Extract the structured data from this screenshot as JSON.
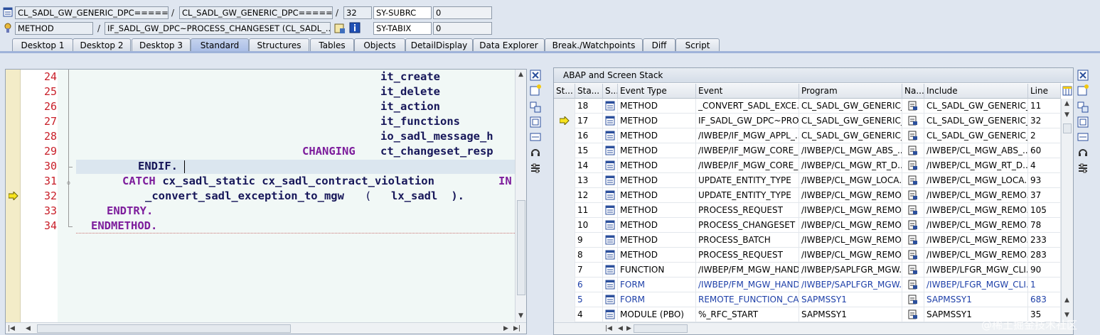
{
  "header": {
    "row1": {
      "field1": "CL_SADL_GW_GENERIC_DPC=======",
      "sep1": "/",
      "field2": "CL_SADL_GW_GENERIC_DPC=======",
      "sep2": "/",
      "line_no": "32",
      "sysvar_name": "SY-SUBRC",
      "sysvar_value": "0"
    },
    "row2": {
      "type": "METHOD",
      "sep": "/",
      "method": "IF_SADL_GW_DPC~PROCESS_CHANGESET (CL_SADL_...",
      "sysvar_name": "SY-TABIX",
      "sysvar_value": "0"
    }
  },
  "tabs": [
    {
      "label": "Desktop 1"
    },
    {
      "label": "Desktop 2"
    },
    {
      "label": "Desktop 3"
    },
    {
      "label": "Standard"
    },
    {
      "label": "Structures"
    },
    {
      "label": "Tables"
    },
    {
      "label": "Objects"
    },
    {
      "label": "DetailDisplay"
    },
    {
      "label": "Data Explorer"
    },
    {
      "label": "Break./Watchpoints"
    },
    {
      "label": "Diff"
    },
    {
      "label": "Script"
    }
  ],
  "code": {
    "lines": [
      {
        "no": "24",
        "parts": [
          {
            "t": "it_create",
            "c": "id"
          }
        ]
      },
      {
        "no": "25",
        "parts": [
          {
            "t": "it_delete",
            "c": "id"
          }
        ]
      },
      {
        "no": "26",
        "parts": [
          {
            "t": "it_action",
            "c": "id"
          }
        ]
      },
      {
        "no": "27",
        "parts": [
          {
            "t": "it_functions",
            "c": "id"
          }
        ]
      },
      {
        "no": "28",
        "parts": [
          {
            "t": "io_sadl_message_h",
            "c": "id"
          }
        ]
      },
      {
        "no": "29",
        "parts": [
          {
            "t": "CHANGING",
            "c": "kw"
          },
          {
            "t": "ct_changeset_resp",
            "c": "id"
          }
        ]
      },
      {
        "no": "30",
        "parts": [
          {
            "t": "ENDIF.",
            "c": "id"
          }
        ]
      },
      {
        "no": "31",
        "parts": [
          {
            "t": "CATCH",
            "c": "kw"
          },
          {
            "t": " cx_sadl_static cx_sadl_contract_violation ",
            "c": "id"
          },
          {
            "t": "IN",
            "c": "kw"
          }
        ]
      },
      {
        "no": "32",
        "parts": [
          {
            "t": "_convert_sadl_exception_to_mgw",
            "c": "id"
          },
          {
            "t": "( ",
            "c": "id"
          },
          {
            "t": "lx_sadl",
            "c": "id"
          },
          {
            "t": " ).",
            "c": "id"
          }
        ]
      },
      {
        "no": "33",
        "parts": [
          {
            "t": "ENDTRY.",
            "c": "kw"
          }
        ]
      },
      {
        "no": "34",
        "parts": [
          {
            "t": "ENDMETHOD.",
            "c": "kw"
          }
        ]
      }
    ]
  },
  "stack": {
    "title": "ABAP and Screen Stack",
    "columns": [
      "St...",
      "Sta...",
      "S...",
      "Event Type",
      "Event",
      "Program",
      "Na...",
      "Include",
      "Line"
    ],
    "rows": [
      {
        "level": "18",
        "type": "METHOD",
        "event": "_CONVERT_SADL_EXCE...",
        "program": "CL_SADL_GW_GENERIC_...",
        "include": "CL_SADL_GW_GENERIC_...",
        "line": "11",
        "current": false,
        "blue": false
      },
      {
        "level": "17",
        "type": "METHOD",
        "event": "IF_SADL_GW_DPC~PRO...",
        "program": "CL_SADL_GW_GENERIC_...",
        "include": "CL_SADL_GW_GENERIC_...",
        "line": "32",
        "current": true,
        "blue": false
      },
      {
        "level": "16",
        "type": "METHOD",
        "event": "/IWBEP/IF_MGW_APPL_...",
        "program": "CL_SADL_GW_GENERIC_...",
        "include": "CL_SADL_GW_GENERIC_...",
        "line": "2",
        "current": false,
        "blue": false
      },
      {
        "level": "15",
        "type": "METHOD",
        "event": "/IWBEP/IF_MGW_CORE_...",
        "program": "/IWBEP/CL_MGW_ABS_...",
        "include": "/IWBEP/CL_MGW_ABS_...",
        "line": "60",
        "current": false,
        "blue": false
      },
      {
        "level": "14",
        "type": "METHOD",
        "event": "/IWBEP/IF_MGW_CORE_...",
        "program": "/IWBEP/CL_MGW_RT_D...",
        "include": "/IWBEP/CL_MGW_RT_D...",
        "line": "4",
        "current": false,
        "blue": false
      },
      {
        "level": "13",
        "type": "METHOD",
        "event": "UPDATE_ENTITY_TYPE",
        "program": "/IWBEP/CL_MGW_LOCA...",
        "include": "/IWBEP/CL_MGW_LOCA...",
        "line": "93",
        "current": false,
        "blue": false
      },
      {
        "level": "12",
        "type": "METHOD",
        "event": "UPDATE_ENTITY_TYPE",
        "program": "/IWBEP/CL_MGW_REMO...",
        "include": "/IWBEP/CL_MGW_REMO...",
        "line": "37",
        "current": false,
        "blue": false
      },
      {
        "level": "11",
        "type": "METHOD",
        "event": "PROCESS_REQUEST",
        "program": "/IWBEP/CL_MGW_REMO...",
        "include": "/IWBEP/CL_MGW_REMO...",
        "line": "105",
        "current": false,
        "blue": false
      },
      {
        "level": "10",
        "type": "METHOD",
        "event": "PROCESS_CHANGESET",
        "program": "/IWBEP/CL_MGW_REMO...",
        "include": "/IWBEP/CL_MGW_REMO...",
        "line": "78",
        "current": false,
        "blue": false
      },
      {
        "level": "9",
        "type": "METHOD",
        "event": "PROCESS_BATCH",
        "program": "/IWBEP/CL_MGW_REMO...",
        "include": "/IWBEP/CL_MGW_REMO...",
        "line": "233",
        "current": false,
        "blue": false
      },
      {
        "level": "8",
        "type": "METHOD",
        "event": "PROCESS_REQUEST",
        "program": "/IWBEP/CL_MGW_REMO...",
        "include": "/IWBEP/CL_MGW_REMO...",
        "line": "283",
        "current": false,
        "blue": false
      },
      {
        "level": "7",
        "type": "FUNCTION",
        "event": "/IWBEP/FM_MGW_HAND...",
        "program": "/IWBEP/SAPLFGR_MGW...",
        "include": "/IWBEP/LFGR_MGW_CLI...",
        "line": "90",
        "current": false,
        "blue": false
      },
      {
        "level": "6",
        "type": "FORM",
        "event": "/IWBEP/FM_MGW_HAND...",
        "program": "/IWBEP/SAPLFGR_MGW...",
        "include": "/IWBEP/LFGR_MGW_CLI...",
        "line": "1",
        "current": false,
        "blue": true
      },
      {
        "level": "5",
        "type": "FORM",
        "event": "REMOTE_FUNCTION_CA...",
        "program": "SAPMSSY1",
        "include": "SAPMSSY1",
        "line": "683",
        "current": false,
        "blue": true
      },
      {
        "level": "4",
        "type": "MODULE (PBO)",
        "event": "%_RFC_START",
        "program": "SAPMSSY1",
        "include": "SAPMSSY1",
        "line": "35",
        "current": false,
        "blue": false
      }
    ]
  },
  "watermark": "@稀土掘金技术社区"
}
